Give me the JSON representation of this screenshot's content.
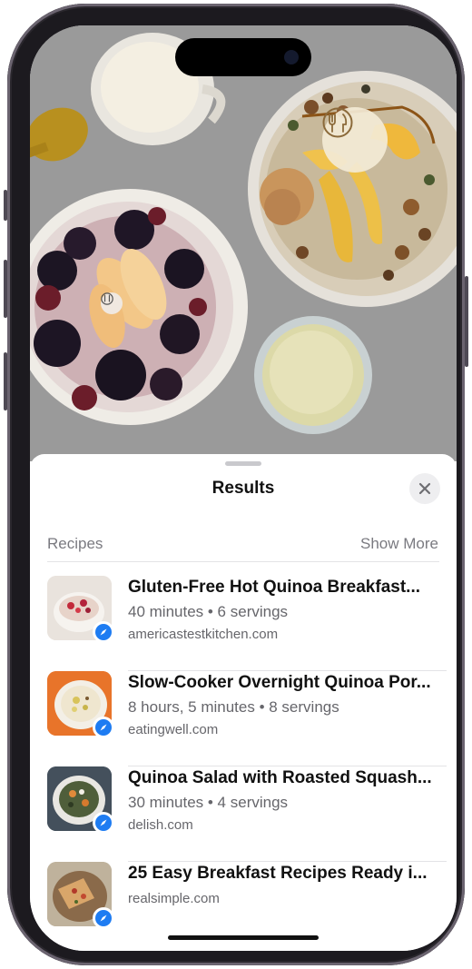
{
  "sheet": {
    "title": "Results",
    "section_label": "Recipes",
    "show_more_label": "Show More"
  },
  "results": [
    {
      "title": "Gluten-Free Hot Quinoa Breakfast...",
      "meta": "40 minutes • 6 servings",
      "source": "americastestkitchen.com",
      "thumb_bg": "#e6dfd8",
      "thumb_icon": "bowl-oatmeal-berries-photo"
    },
    {
      "title": "Slow-Cooker Overnight Quinoa Por...",
      "meta": "8 hours, 5 minutes • 8 servings",
      "source": "eatingwell.com",
      "thumb_bg": "#e8742a",
      "thumb_icon": "bowl-porridge-photo"
    },
    {
      "title": "Quinoa Salad with Roasted Squash...",
      "meta": "30 minutes • 4 servings",
      "source": "delish.com",
      "thumb_bg": "#3c4a5a",
      "thumb_icon": "bowl-salad-photo"
    },
    {
      "title": "25 Easy Breakfast Recipes Ready i...",
      "meta": "",
      "source": "realsimple.com",
      "thumb_bg": "#b9ab95",
      "thumb_icon": "plate-flatbread-photo"
    }
  ],
  "icons": {
    "visual_lookup_main": "fork-knife-icon",
    "visual_lookup_small": "fork-knife-icon",
    "close": "close-icon",
    "source_badge": "safari-compass-icon"
  },
  "colors": {
    "accent_badge": "#1e7cf2",
    "sheet_bg": "#ffffff",
    "secondary_text": "#66666b"
  }
}
